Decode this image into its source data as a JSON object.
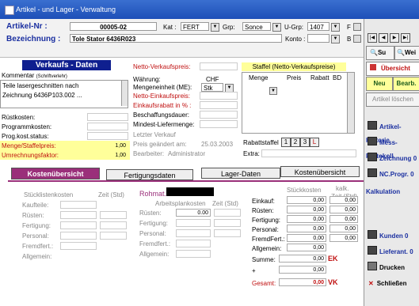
{
  "window": {
    "title": "Artikel - und Lager - Verwaltung"
  },
  "header": {
    "artikel_label": "Artikel-Nr :",
    "artikel_value": "00005-02",
    "kat_label": "Kat :",
    "kat_value": "FERT",
    "grp_label": "Grp:",
    "grp_value": "Sonce",
    "ugrp_label": "U-Grp:",
    "ugrp_value": "1407",
    "f_label": "F",
    "b_label": "B",
    "bezeichnung_label": "Bezeichnung :",
    "bezeichnung_value": "Tole Stator 6436R023",
    "konto_label": "Konto :"
  },
  "verkauf": {
    "title": "Verkaufs - Daten",
    "kommentar_label": "Kommentar",
    "kommentar_hint": "(Schriftverlehr)",
    "comment_lines": [
      "Teile lasergeschnitten nach",
      "Zeichnung 6436P103.002 ..."
    ],
    "rows": [
      {
        "label": "Rüstkosten:",
        "value": ""
      },
      {
        "label": "Programmkosten:",
        "value": ""
      },
      {
        "label": "Prog.kost.status:",
        "value": ""
      },
      {
        "label": "Menge/Staffelpreis:",
        "value": "1,00"
      },
      {
        "label": "Umrechnungsfaktor:",
        "value": "1,00"
      }
    ]
  },
  "netto": {
    "preis_label": "Netto-Verkaufspreis:",
    "waehrung_label": "Währung:",
    "waehrung_value": "CHF",
    "me_label": "Mengeneinheit (ME):",
    "me_value": "Stk",
    "einkaufspreis_label": "Netto-Einkaufspreis:",
    "rabatt_label": "Einkaufsrabatt in % :",
    "beschaffung_label": "Beschaffungsdauer:",
    "mindest_label": "Mindest-Liefermenge:",
    "letzter_label": "Letzter Verkauf",
    "geaendert_label": "Preis geändert am:",
    "geaendert_value": "25.03.2003",
    "bearbeiter_label": "Bearbeiter:",
    "bearbeiter_value": "Administrator"
  },
  "staffel": {
    "title": "Staffel (Netto-Verkaufspreise)",
    "columns": [
      "Menge",
      "Preis",
      "Rabatt",
      "BD"
    ],
    "tabs_label": "Rabattstaffel",
    "pages": [
      "1",
      "2",
      "3",
      "L"
    ],
    "extra_label": "Extra:"
  },
  "tabs": [
    "Kostenübersicht",
    "Fertigungsdaten",
    "Lager-Daten",
    "Kostenübersicht"
  ],
  "kosten": {
    "stueckliste_label": "Stücklistenkosten",
    "zeit_label": "Zeit (Std)",
    "left_rows": [
      "Kaufteile:",
      "Rüsten:",
      "Fertigung:",
      "Personal:",
      "Fremdfert.:",
      "Allgemein:"
    ],
    "rohmat_label": "Rohmat.",
    "arbeitsplan_label": "Arbeitsplankosten",
    "arbeitsplan_zeit_label": "Zeit (Std)",
    "mid_rows": [
      "Rüsten:",
      "Fertigung:",
      "Personal:",
      "Fremdfert.:",
      "Allgemein:"
    ],
    "mid_first_value": "0.00",
    "stueck_label": "Stückkosten",
    "kalk_label": "kalk.",
    "kalk_zeit_label": "Zeit (Std)",
    "right_rows": [
      {
        "label": "Einkauf:",
        "value": "0,00",
        "zeit": "0,00"
      },
      {
        "label": "Rüsten:",
        "value": "0,00",
        "zeit": "0,00"
      },
      {
        "label": "Fertigung:",
        "value": "0,00",
        "zeit": "0,00"
      },
      {
        "label": "Personal:",
        "value": "0,00",
        "zeit": "0,00"
      },
      {
        "label": "FremdFert.:",
        "value": "0,00",
        "zeit": "0,00"
      },
      {
        "label": "Allgemein:",
        "value": "0,00",
        "zeit": ""
      }
    ],
    "summe_label": "Summe:",
    "summe_value": "0,00",
    "summe_btn": "EK",
    "plus_label": "+",
    "plus_value": "0,00",
    "gesamt_label": "Gesamt:",
    "gesamt_value": "0,00",
    "gesamt_btn": "VK"
  },
  "sidebar": {
    "nav": [
      "|◀",
      "◀",
      "▶",
      "▶|"
    ],
    "su_label": "Su",
    "wei_label": "Wei",
    "uebersicht": "Übersicht",
    "neu": "Neu",
    "bearb": "Bearb.",
    "loeschen": "Artikel löschen",
    "items": [
      {
        "label": "Artikel-Historie"
      },
      {
        "label": "Mess-Protokoll"
      },
      {
        "label": "Zeichnung",
        "count": "0"
      },
      {
        "label": "NC.Progr.",
        "count": "0"
      }
    ],
    "kalkulation": "Kalkulation",
    "kunden": "Kunden",
    "kunden_count": "0",
    "lieferant": "Lieferant.",
    "lieferant_count": "0",
    "drucken": "Drucken",
    "schliessen": "Schließen"
  },
  "colors": {
    "title_blue": "#1d4fb8",
    "tab_active": "#9a2f7a",
    "section_navy": "#0f1f8f",
    "label_red": "#c01010"
  }
}
